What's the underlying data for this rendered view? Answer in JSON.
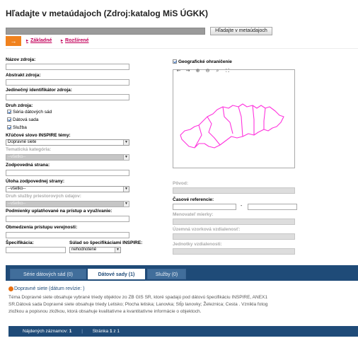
{
  "page": {
    "title": "Hľadajte v metaúdajoch (Zdroj:katalog MiS ÚGKK)",
    "search_button": "Hľadajte v metaúdajoch",
    "mode_basic": "Základné",
    "mode_advanced": "Rozšírené"
  },
  "left_form": {
    "resource_name": "Názov zdroja:",
    "resource_abstract": "Abstrakt zdroja:",
    "unique_identifier": "Jedinečný identifikátor zdroja:",
    "resource_type": "Druh zdroja:",
    "types": [
      "Séria dátových sád",
      "Dátová sada",
      "Služba"
    ],
    "inspire_keyword": "Kľúčové slovo INSPIRE témy:",
    "inspire_keyword_value": "Dopravné siete",
    "thematic_category": "Tematická kategória:",
    "thematic_category_value": "--všetko--",
    "responsible_party": "Zodpovedná strana:",
    "responsible_role": "Úloha zodpovednej strany:",
    "responsible_role_value": "--všetko--",
    "service_type": "Druh služby priestorových údajov:",
    "service_type_value": "--všetko--",
    "access_conditions": "Podmienky uplatňované na prístup a využívanie:",
    "access_limits": "Obmedzenia prístupu verejnosti:",
    "specification": "Špecifikácia:",
    "conformity": "Súlad so špecifikáciami INSPIRE:",
    "conformity_value": "nehodnotené"
  },
  "right_form": {
    "geo_limit": "Geografické ohraničenie",
    "lineage": "Pôvod:",
    "temporal_ref": "Časové referencie:",
    "date_sep": "-",
    "scale_denominator": "Menovateľ mierky:",
    "resolution_distance": "Územná vzorková vzdialenosť:",
    "distance_units": "Jednotky vzdialenosti:"
  },
  "map_tools": [
    "←",
    "→",
    "⊕",
    "⊖",
    "⌕",
    "⛶"
  ],
  "tabs": [
    {
      "label": "Série dátových sád (0)",
      "active": false
    },
    {
      "label": "Dátové sady (1)",
      "active": true
    },
    {
      "label": "Služby (0)",
      "active": false
    }
  ],
  "result": {
    "title": "Dopravné siete  (dátum revízie: )",
    "desc1": "Téma Dopravné siete obsahuje vybrané triedy objektov zo ZB GIS SR, ktoré spadajú pod dátovú špecifikáciu INSPIRE, ANEX1",
    "desc2": "SR.Dátová sada Dopravné siete obsahuje triedy Letisko; Plocha letiska; Lanovka; Stĺp lanovky; Železnica; Cesta . Vznikla fotog",
    "desc3": "zložkou a popisnou zložkou, ktorá obsahuje kvalitatívne a kvantitatívne informácie o objektoch."
  },
  "footer": {
    "found_label": "Nájdených záznamov:",
    "found_value": "1",
    "page_label": "Stránka",
    "page_value": "1",
    "page_of": "z 1"
  },
  "colors": {
    "accent_orange": "#f0821e",
    "link_magenta": "#c3005a",
    "tab_blue": "#1f4b78",
    "map_outline": "#ff33dd"
  }
}
